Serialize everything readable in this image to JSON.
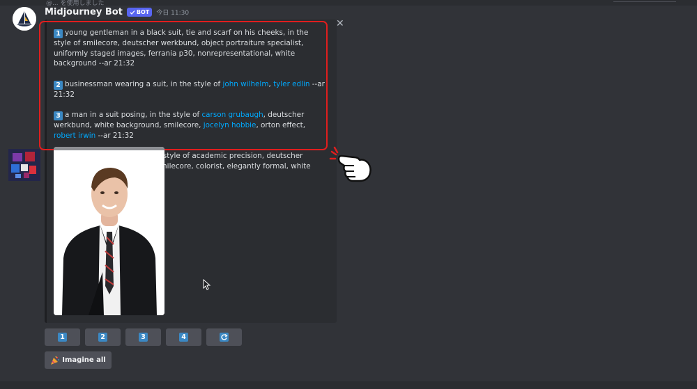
{
  "message": {
    "username": "Midjourney Bot",
    "badge": "BOT",
    "timestamp": "今日 11:30",
    "reply_ref": "@... を使用しました"
  },
  "prompts": [
    {
      "num": "1",
      "parts": [
        {
          "text": "young gentleman in a black suit, tie and scarf on his cheeks, in the style of smilecore, deutscher werkbund, object portraiture specialist, uniformly staged images, ferrania p30, nonrepresentational, white background --ar 21:32",
          "link": false
        }
      ]
    },
    {
      "num": "2",
      "parts": [
        {
          "text": "businessman wearing a suit, in the style of ",
          "link": false
        },
        {
          "text": "john wilhelm",
          "link": true
        },
        {
          "text": ", ",
          "link": false
        },
        {
          "text": "tyler edlin",
          "link": true
        },
        {
          "text": " --ar 21:32",
          "link": false
        }
      ]
    },
    {
      "num": "3",
      "parts": [
        {
          "text": "a man in a suit posing, in the style of ",
          "link": false
        },
        {
          "text": "carson grubaugh",
          "link": true
        },
        {
          "text": ", deutscher werkbund, white background, smilecore, ",
          "link": false
        },
        {
          "text": "jocelyn hobbie",
          "link": true
        },
        {
          "text": ", orton effect, ",
          "link": false
        },
        {
          "text": "robert irwin",
          "link": true
        },
        {
          "text": " --ar 21:32",
          "link": false
        }
      ]
    },
    {
      "num": "4",
      "parts": [
        {
          "text": "man in black jacket, in the style of academic precision, deutscher werkbund, youthful energy, smilecore, colorist, elegantly formal, white background --ar 21:32",
          "link": false
        }
      ]
    }
  ],
  "buttons": [
    "1",
    "2",
    "3",
    "4"
  ],
  "imagine_all_label": "Imagine all",
  "icons": {
    "close": "close-icon",
    "refresh": "refresh-icon",
    "imagine": "party-popper-icon",
    "pointer": "pointing-hand-icon",
    "cursor": "mouse-cursor-icon"
  },
  "colors": {
    "highlight_border": "#e01e1e",
    "link": "#00a8fc",
    "number_badge": "#3b88c3",
    "bot_badge": "#5865f2"
  }
}
